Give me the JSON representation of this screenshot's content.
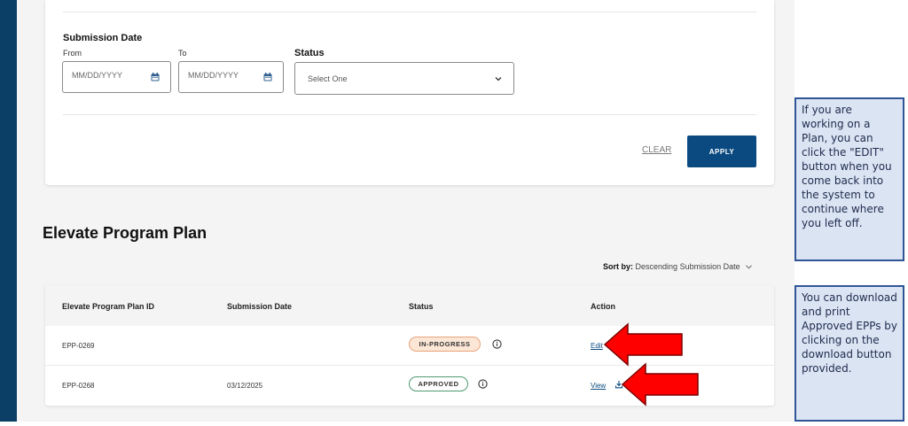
{
  "filters": {
    "submission_date_label": "Submission Date",
    "from_label": "From",
    "to_label": "To",
    "from_placeholder": "MM/DD/YYYY",
    "to_placeholder": "MM/DD/YYYY",
    "status_label": "Status",
    "status_value": "Select One",
    "clear_label": "CLEAR",
    "apply_label": "APPLY"
  },
  "section": {
    "title": "Elevate Program Plan",
    "sort_label": "Sort by:",
    "sort_value": "Descending Submission Date"
  },
  "table": {
    "headers": [
      "Elevate Program Plan ID",
      "Submission Date",
      "Status",
      "Action"
    ],
    "rows": [
      {
        "id": "EPP-0269",
        "date": "",
        "status": "IN-PROGRESS",
        "action": "Edit"
      },
      {
        "id": "EPP-0268",
        "date": "03/12/2025",
        "status": "APPROVED",
        "action": "View"
      }
    ]
  },
  "notes": {
    "edit_note": "If you are working on a Plan, you can click the \"EDIT\" button when you come back into the system to continue where you left off.",
    "download_note": "You can download and print Approved EPPs by clicking on the download button provided."
  },
  "colors": {
    "sidebar": "#0b3f66",
    "apply_button": "#0b4a80",
    "in_progress_badge": "#fce6d6",
    "approved_border": "#4d9a70",
    "arrow": "#ff0000",
    "note_bg": "#dbe4f3",
    "note_border": "#2f5597"
  },
  "icons": [
    "calendar-icon",
    "chevron-down-icon",
    "info-icon",
    "download-icon",
    "arrow-pointer-icon"
  ]
}
